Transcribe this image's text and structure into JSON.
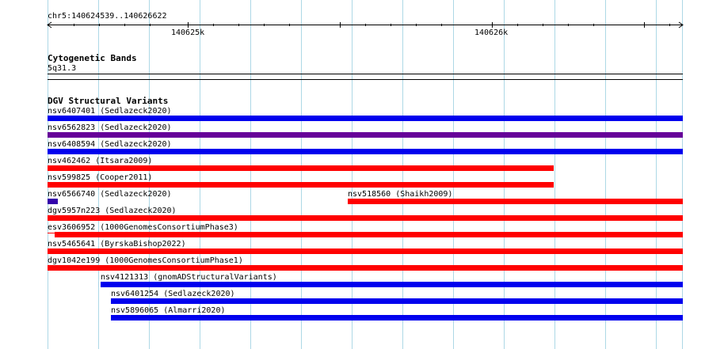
{
  "ruler": {
    "location": "chr5:140624539..140626622",
    "ticks": [
      "140625k",
      "140626k"
    ]
  },
  "cytoband_track": {
    "title": "Cytogenetic Bands",
    "band": "5q31.3"
  },
  "dgv_track": {
    "title": "DGV Structural Variants",
    "colors": {
      "gain": "#0000ee",
      "loss": "#ff0000",
      "both": "#660099",
      "gain_dark": "#3300aa"
    },
    "features": [
      {
        "label": "nsv6407401 (Sedlazeck2020)",
        "type": "gain"
      },
      {
        "label": "nsv6562823 (Sedlazeck2020)",
        "type": "both"
      },
      {
        "label": "nsv6408594 (Sedlazeck2020)",
        "type": "gain"
      },
      {
        "label": "nsv462462 (Itsara2009)",
        "type": "loss"
      },
      {
        "label": "nsv599825 (Cooper2011)",
        "type": "loss"
      },
      {
        "label": "nsv6566740 (Sedlazeck2020)",
        "type": "gain_dark"
      },
      {
        "label": "nsv518560 (Shaikh2009)",
        "type": "loss"
      },
      {
        "label": "dgv5957n223 (Sedlazeck2020)",
        "type": "loss"
      },
      {
        "label": "esv3606952 (1000GenomesConsortiumPhase3)",
        "type": "loss"
      },
      {
        "label": "nsv5465641 (ByrskaBishop2022)",
        "type": "loss"
      },
      {
        "label": "dgv1042e199 (1000GenomesConsortiumPhase1)",
        "type": "loss"
      },
      {
        "label": "nsv4121313 (gnomADStructuralVariants)",
        "type": "gain"
      },
      {
        "label": "nsv6401254 (Sedlazeck2020)",
        "type": "gain"
      },
      {
        "label": "nsv5896065 (Almarri2020)",
        "type": "gain"
      }
    ]
  }
}
